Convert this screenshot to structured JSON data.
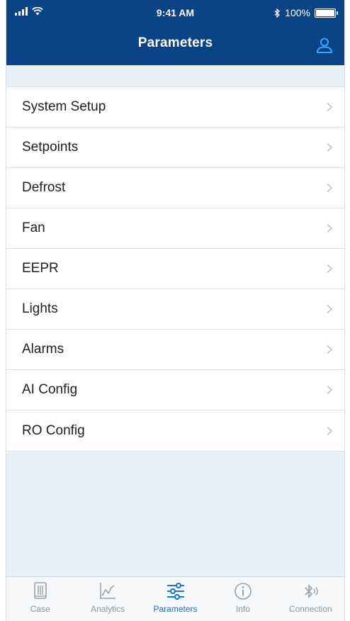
{
  "status_bar": {
    "time": "9:41 AM",
    "battery": "100%",
    "battery_level": 1.0
  },
  "header": {
    "title": "Parameters",
    "user_icon": "user-icon"
  },
  "menu": {
    "items": [
      {
        "label": "System Setup"
      },
      {
        "label": "Setpoints"
      },
      {
        "label": "Defrost"
      },
      {
        "label": "Fan"
      },
      {
        "label": "EEPR"
      },
      {
        "label": "Lights"
      },
      {
        "label": "Alarms"
      },
      {
        "label": "AI Config"
      },
      {
        "label": "RO Config"
      }
    ]
  },
  "tabbar": {
    "tabs": [
      {
        "label": "Case",
        "icon": "case-icon",
        "active": false
      },
      {
        "label": "Analytics",
        "icon": "analytics-icon",
        "active": false
      },
      {
        "label": "Parameters",
        "icon": "sliders-icon",
        "active": true
      },
      {
        "label": "Info",
        "icon": "info-icon",
        "active": false
      },
      {
        "label": "Connection",
        "icon": "bluetooth-icon",
        "active": false
      }
    ]
  },
  "colors": {
    "header_bg": "#0b4387",
    "accent": "#1a73c8",
    "page_bg": "#e9f0f6",
    "inactive_tab": "#8f969d"
  }
}
